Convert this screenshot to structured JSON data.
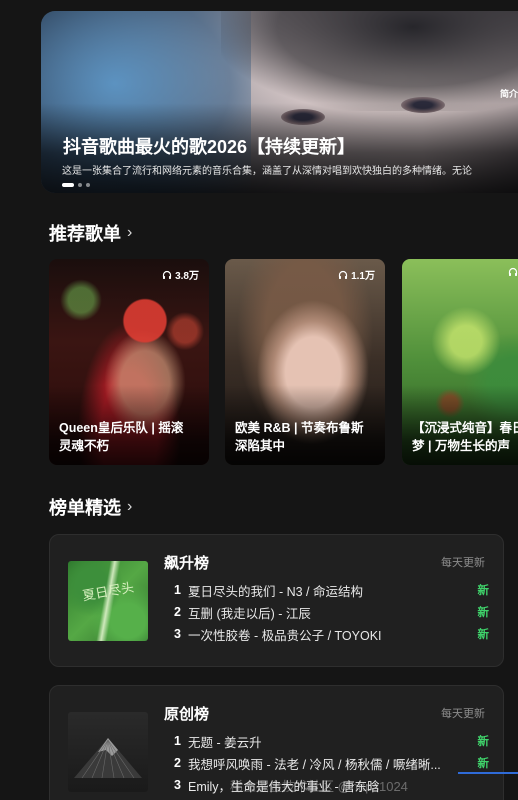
{
  "banner": {
    "title": "抖音歌曲最火的歌2026【持续更新】",
    "description": "这是一张集合了流行和网络元素的音乐合集，涵盖了从深情对唱到欢快独白的多种情绪。无论",
    "corner_text": "简介",
    "pagination": {
      "count": 3,
      "active": 0
    }
  },
  "recommend": {
    "title": "推荐歌单",
    "chevron": "›",
    "playlists": [
      {
        "name": "Queen皇后乐队 | 摇滚\n灵魂不朽",
        "plays": "3.8万",
        "icon": "headphones-icon"
      },
      {
        "name": "欧美 R&B | 节奏布鲁斯\n深陷其中",
        "plays": "1.1万",
        "icon": "headphones-icon"
      },
      {
        "name": "【沉浸式纯音】春日\n梦 | 万物生长的声",
        "plays": "",
        "icon": "headphones-icon"
      }
    ]
  },
  "charts": {
    "title": "榜单精选",
    "chevron": "›",
    "lists": [
      {
        "title": "飙升榜",
        "update": "每天更新",
        "cover_text": "夏日尽头",
        "songs": [
          {
            "rank": "1",
            "text": "夏日尽头的我们 - N3 / 命运结构",
            "tag": "新"
          },
          {
            "rank": "2",
            "text": "互删 (我走以后) - 江辰",
            "tag": "新"
          },
          {
            "rank": "3",
            "text": "一次性胶卷 - 极品贵公子 / TOYOKI",
            "tag": "新"
          }
        ]
      },
      {
        "title": "原创榜",
        "update": "每天更新",
        "cover_text": "",
        "songs": [
          {
            "rank": "1",
            "text": "无题 - 姜云升",
            "tag": "新"
          },
          {
            "rank": "2",
            "text": "我想呼风唤雨 - 法老 / 冷风 / 杨秋儒 / 噘绪晰...",
            "tag": "新"
          },
          {
            "rank": "3",
            "text": "Emily，生命是伟大的事业 - 唐东晗",
            "tag": ""
          }
        ]
      }
    ]
  },
  "overlay": {
    "watermark": "稀土掘金技术社区 @https1024"
  },
  "colors": {
    "background": "#151515",
    "card": "#202020",
    "new_tag": "#3fd16a",
    "muted": "#8c8c8c"
  }
}
